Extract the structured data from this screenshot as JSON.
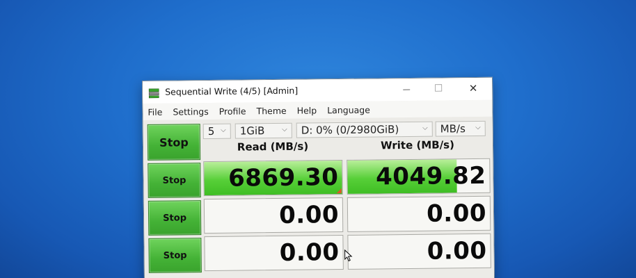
{
  "window": {
    "title": "Sequential Write (4/5) [Admin]",
    "controls": {
      "minimize": "—",
      "maximize": "☐",
      "close": "✕"
    }
  },
  "menu": [
    "File",
    "Settings",
    "Profile",
    "Theme",
    "Help",
    "Language"
  ],
  "toolbar": {
    "all_button": "Stop",
    "count": "5",
    "size": "1GiB",
    "drive": "D: 0% (0/2980GiB)",
    "unit": "MB/s"
  },
  "headers": {
    "read": "Read (MB/s)",
    "write": "Write (MB/s)"
  },
  "rows": [
    {
      "button": "Stop",
      "read": "6869.30",
      "write": "4049.82",
      "read_fill": 1.0,
      "write_fill": 0.77
    },
    {
      "button": "Stop",
      "read": "0.00",
      "write": "0.00",
      "read_fill": 0,
      "write_fill": 0
    },
    {
      "button": "Stop",
      "read": "0.00",
      "write": "0.00",
      "read_fill": 0,
      "write_fill": 0
    }
  ],
  "colors": {
    "button_green": "#44b236",
    "bar_green": "#57cf38",
    "desktop_blue": "#1f6ecc"
  }
}
